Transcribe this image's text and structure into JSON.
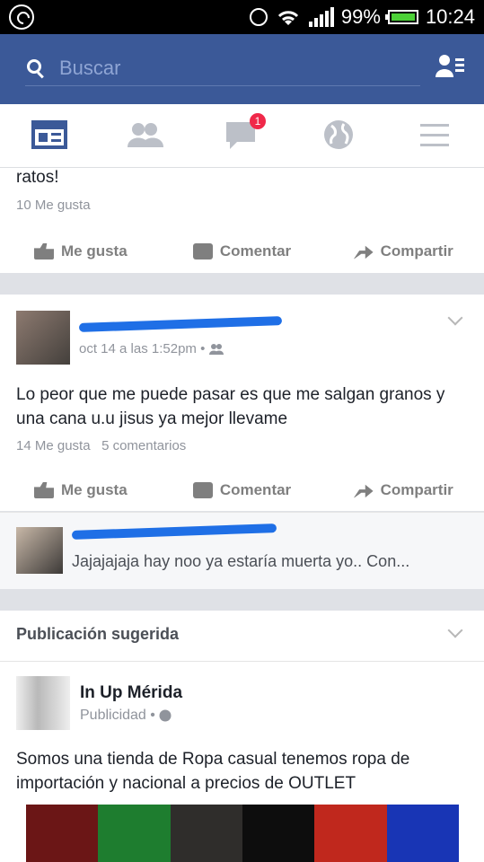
{
  "status_bar": {
    "battery_text": "99%",
    "time": "10:24"
  },
  "search": {
    "placeholder": "Buscar"
  },
  "tabs": {
    "notifications_count": "1"
  },
  "post_partial": {
    "text": "ratos!",
    "likes": "10 Me gusta"
  },
  "actions": {
    "like": "Me gusta",
    "comment": "Comentar",
    "share": "Compartir"
  },
  "post": {
    "meta": "oct 14 a las 1:52pm •",
    "text": "Lo peor que me puede pasar es que me salgan granos y una cana u.u jisus ya mejor llevame",
    "likes": "14 Me gusta",
    "comments": "5 comentarios"
  },
  "comment": {
    "text": "Jajajajaja hay noo ya estaría muerta yo.. Con..."
  },
  "suggested": {
    "header": "Publicación sugerida",
    "page_name": "In Up Mérida",
    "sponsored": "Publicidad •",
    "text": "Somos una tienda de Ropa casual tenemos ropa de importación y nacional a precios de OUTLET"
  },
  "colors": {
    "brand": "#3b5998",
    "badge": "#f02849"
  }
}
